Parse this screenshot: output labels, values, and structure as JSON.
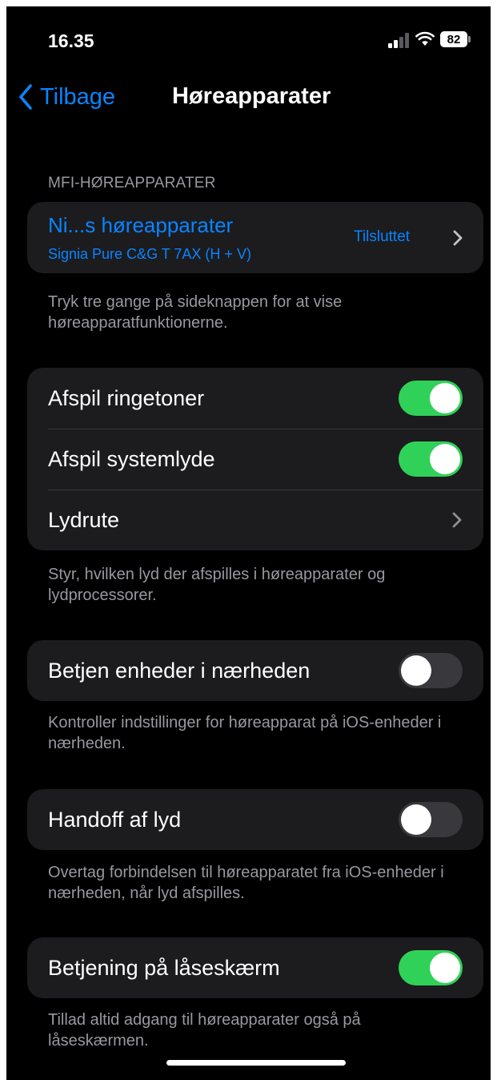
{
  "status_bar": {
    "time": "16.35",
    "battery": "82"
  },
  "nav": {
    "back_label": "Tilbage",
    "title": "Høreapparater"
  },
  "mfi": {
    "header": "MFI-HØREAPPARATER",
    "device_name": "Ni...s høreapparater",
    "device_model": "Signia Pure C&G T 7AX (H + V)",
    "device_status": "Tilsluttet",
    "footer": "Tryk tre gange på sideknappen for at vise høreapparatfunktionerne."
  },
  "audio": {
    "ringtones_label": "Afspil ringetoner",
    "ringtones_on": true,
    "system_sounds_label": "Afspil systemlyde",
    "system_sounds_on": true,
    "route_label": "Lydrute",
    "footer": "Styr, hvilken lyd der afspilles i høreapparater og lydprocessorer."
  },
  "nearby": {
    "label": "Betjen enheder i nærheden",
    "on": false,
    "footer": "Kontroller indstillinger for høreapparat på iOS-enheder i nærheden."
  },
  "handoff": {
    "label": "Handoff af lyd",
    "on": false,
    "footer": "Overtag forbindelsen til høreapparatet fra iOS-enheder i nærheden, når lyd afspilles."
  },
  "lockscreen": {
    "label": "Betjening på låseskærm",
    "on": true,
    "footer": "Tillad altid adgang til høreapparater også på låseskærmen."
  },
  "colors": {
    "accent": "#0a84ff",
    "toggle_on": "#30d158",
    "toggle_off": "#39393d",
    "cell": "#1c1c1e"
  }
}
